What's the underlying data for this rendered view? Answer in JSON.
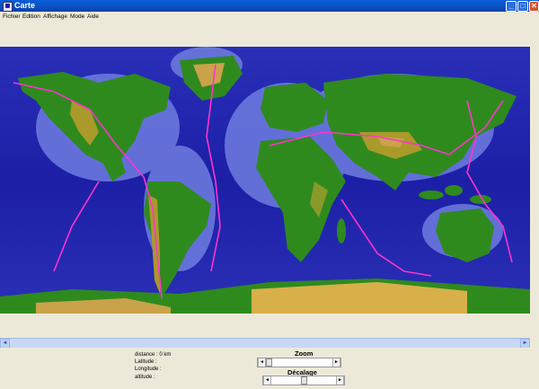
{
  "window": {
    "title": "Carte",
    "icon": "map-app-icon"
  },
  "window_controls": {
    "minimize_label": "_",
    "maximize_label": "□",
    "close_label": "✕"
  },
  "menu": [
    "Fichier",
    "Edition",
    "Affichage",
    "Mode",
    "Aide"
  ],
  "map": {
    "description_icon": "world-map",
    "colors": {
      "ocean": "#1c1fa6",
      "shelf": "#7a86e8",
      "land": "#2f8a1e",
      "highland": "#b39a2a",
      "ice": "#d8c08a",
      "plate_boundary": "#ff33cc"
    }
  },
  "scroll": {
    "left_arrow": "◄",
    "right_arrow": "►"
  },
  "info": {
    "distance": "distance : 0 km",
    "latitude": "Latitude :",
    "longitude": "Longitude :",
    "altitude": "altitude :"
  },
  "zoom": {
    "label": "Zoom",
    "left_arrow": "◄",
    "right_arrow": "►",
    "level": 0
  },
  "offset": {
    "label": "Décalage",
    "left_arrow": "◄",
    "right_arrow": "►",
    "level": 0.5
  }
}
